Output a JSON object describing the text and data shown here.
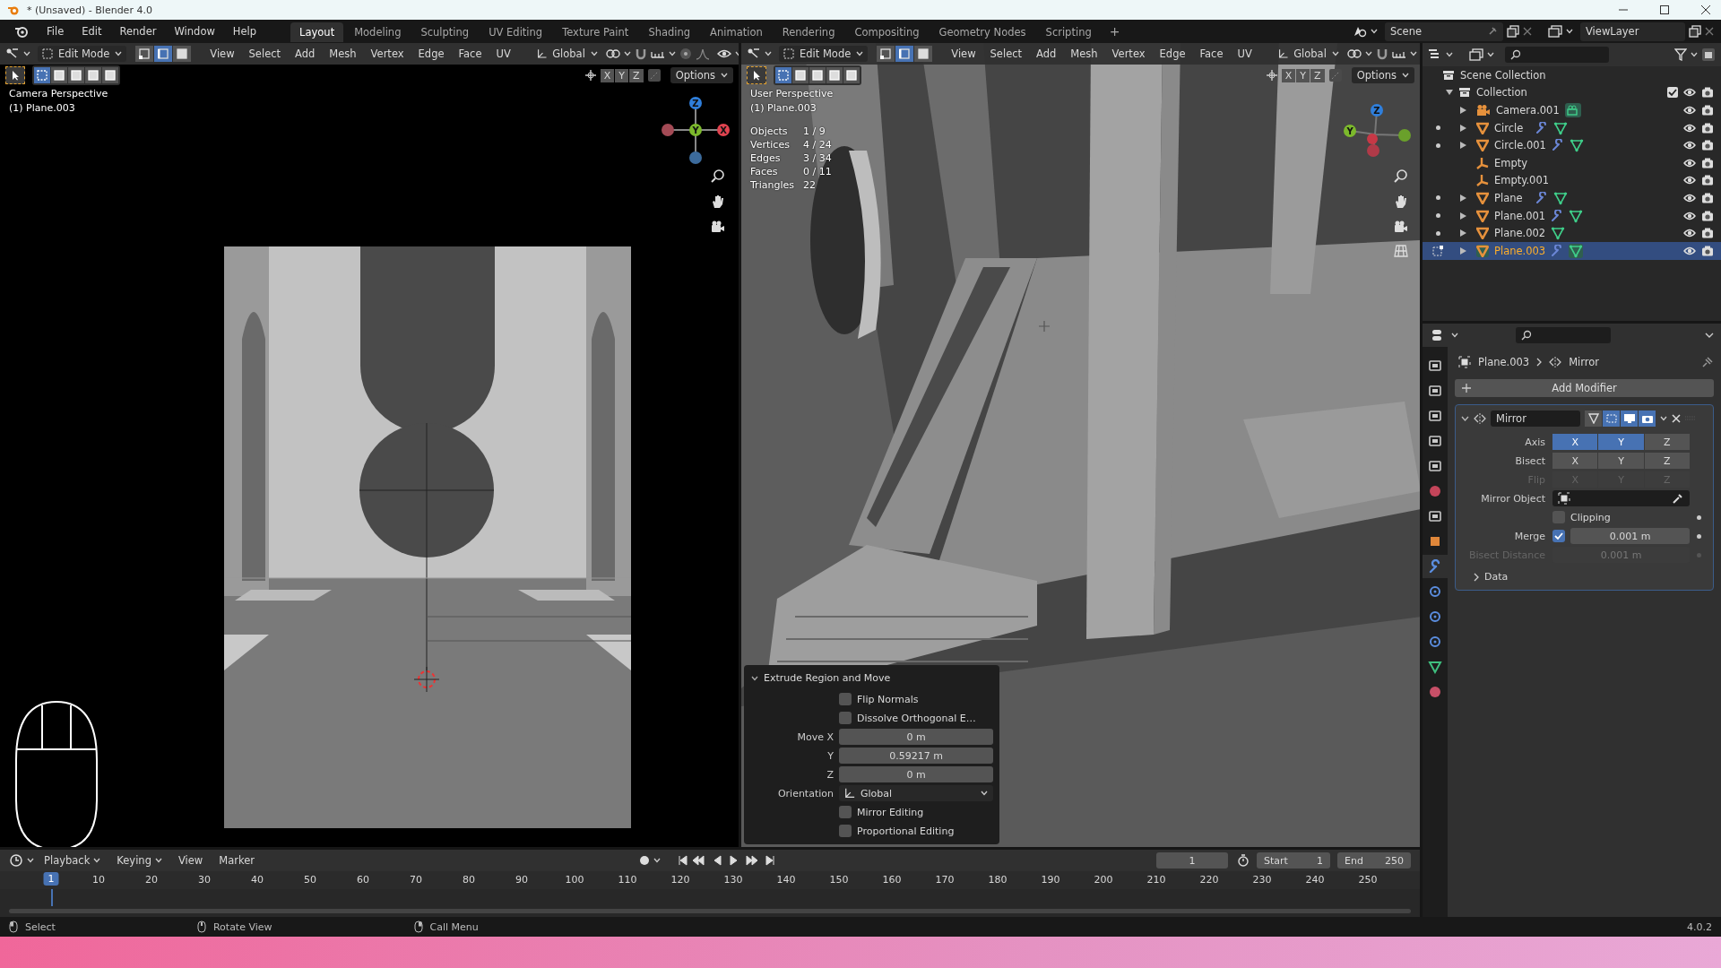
{
  "window": {
    "title": "* (Unsaved) - Blender 4.0"
  },
  "menu_bar": [
    "File",
    "Edit",
    "Render",
    "Window",
    "Help"
  ],
  "workspace_tabs": [
    {
      "label": "Layout",
      "selected": true
    },
    {
      "label": "Modeling",
      "selected": false
    },
    {
      "label": "Sculpting",
      "selected": false
    },
    {
      "label": "UV Editing",
      "selected": false
    },
    {
      "label": "Texture Paint",
      "selected": false
    },
    {
      "label": "Shading",
      "selected": false
    },
    {
      "label": "Animation",
      "selected": false
    },
    {
      "label": "Rendering",
      "selected": false
    },
    {
      "label": "Compositing",
      "selected": false
    },
    {
      "label": "Geometry Nodes",
      "selected": false
    },
    {
      "label": "Scripting",
      "selected": false
    }
  ],
  "add_tab": "+",
  "scene": "Scene",
  "view_layer": "ViewLayer",
  "viewports": [
    {
      "kind": "camera",
      "mode": "Edit Mode",
      "select_modes": [
        {
          "selected": false
        },
        {
          "selected": true
        },
        {
          "selected": false
        }
      ],
      "menus": [
        "View",
        "Select",
        "Add",
        "Mesh",
        "Vertex",
        "Edge",
        "Face",
        "UV"
      ],
      "orientation": "Global",
      "axis_toggles": [
        "X",
        "Y",
        "Z"
      ],
      "options": "Options",
      "view_name": "Camera Perspective",
      "object_label": "(1) Plane.003",
      "gizmo": [
        "Z",
        "Y",
        "X"
      ]
    },
    {
      "kind": "user",
      "mode": "Edit Mode",
      "select_modes": [
        {
          "selected": false
        },
        {
          "selected": true
        },
        {
          "selected": false
        }
      ],
      "menus": [
        "View",
        "Select",
        "Add",
        "Mesh",
        "Vertex",
        "Edge",
        "Face",
        "UV"
      ],
      "orientation": "Global",
      "axis_toggles": [
        "X",
        "Y",
        "Z"
      ],
      "options": "Options",
      "view_name": "User Perspective",
      "object_label": "(1) Plane.003",
      "gizmo": [
        "Z",
        "Y"
      ],
      "stats": [
        {
          "label": "Objects",
          "value": "1 / 9"
        },
        {
          "label": "Vertices",
          "value": "4 / 24"
        },
        {
          "label": "Edges",
          "value": "3 / 34"
        },
        {
          "label": "Faces",
          "value": "0 / 11"
        },
        {
          "label": "Triangles",
          "value": "22"
        }
      ]
    }
  ],
  "operator_panel": {
    "title": "Extrude Region and Move",
    "expanded": true,
    "rows": [
      {
        "kind": "checkbox",
        "label": "Flip Normals",
        "checked": false
      },
      {
        "kind": "checkbox",
        "label": "Dissolve Orthogonal E…",
        "checked": false
      },
      {
        "kind": "value",
        "label": "Move X",
        "value": "0 m"
      },
      {
        "kind": "value",
        "label": "Y",
        "value": "0.59217 m"
      },
      {
        "kind": "value",
        "label": "Z",
        "value": "0 m"
      },
      {
        "kind": "dropdown",
        "label": "Orientation",
        "value": "Global"
      },
      {
        "kind": "checkbox",
        "label": "Mirror Editing",
        "checked": false
      },
      {
        "kind": "checkbox",
        "label": "Proportional Editing",
        "checked": false
      }
    ]
  },
  "outliner": {
    "scene_collection": "Scene Collection",
    "collection": {
      "label": "Collection",
      "expanded": true,
      "checked": true
    },
    "objects": [
      {
        "name": "Camera.001",
        "kind": "camera",
        "has_children": true,
        "modifier": false,
        "data": true,
        "editable": false,
        "edit_mode": false,
        "selected": false
      },
      {
        "name": "Circle",
        "kind": "mesh",
        "has_children": true,
        "modifier": true,
        "data": true,
        "editable": true,
        "edit_mode": false,
        "selected": false
      },
      {
        "name": "Circle.001",
        "kind": "mesh",
        "has_children": true,
        "modifier": true,
        "data": true,
        "editable": true,
        "edit_mode": false,
        "selected": false
      },
      {
        "name": "Empty",
        "kind": "empty",
        "has_children": false,
        "modifier": false,
        "data": false,
        "editable": false,
        "edit_mode": false,
        "selected": false
      },
      {
        "name": "Empty.001",
        "kind": "empty",
        "has_children": false,
        "modifier": false,
        "data": false,
        "editable": false,
        "edit_mode": false,
        "selected": false
      },
      {
        "name": "Plane",
        "kind": "mesh",
        "has_children": true,
        "modifier": true,
        "data": true,
        "editable": true,
        "edit_mode": false,
        "selected": false
      },
      {
        "name": "Plane.001",
        "kind": "mesh",
        "has_children": true,
        "modifier": true,
        "data": true,
        "editable": true,
        "edit_mode": false,
        "selected": false
      },
      {
        "name": "Plane.002",
        "kind": "mesh",
        "has_children": true,
        "modifier": false,
        "data": true,
        "editable": true,
        "edit_mode": false,
        "selected": false
      },
      {
        "name": "Plane.003",
        "kind": "mesh",
        "has_children": true,
        "modifier": true,
        "data": true,
        "editable": true,
        "edit_mode": true,
        "selected": true
      }
    ]
  },
  "properties": {
    "tabs": [
      {
        "kind": "tool",
        "selected": false
      },
      {
        "kind": "render",
        "selected": false
      },
      {
        "kind": "output",
        "selected": false
      },
      {
        "kind": "view_layer",
        "selected": false
      },
      {
        "kind": "scene",
        "selected": false
      },
      {
        "kind": "world",
        "selected": false
      },
      {
        "kind": "collection",
        "selected": false
      },
      {
        "kind": "object",
        "selected": false
      },
      {
        "kind": "modifiers",
        "selected": true
      },
      {
        "kind": "particles",
        "selected": false
      },
      {
        "kind": "physics",
        "selected": false
      },
      {
        "kind": "constraints",
        "selected": false
      },
      {
        "kind": "data",
        "selected": false
      },
      {
        "kind": "material",
        "selected": false
      }
    ],
    "breadcrumb": [
      "Plane.003",
      "Mirror"
    ],
    "add_modifier": "Add Modifier",
    "modifier": {
      "name": "Mirror",
      "expanded": true,
      "toggles": [
        {
          "selected": false
        },
        {
          "selected": true
        },
        {
          "selected": true
        },
        {
          "selected": true
        }
      ],
      "rows": [
        {
          "kind": "toggles",
          "label": "Axis",
          "disabled": false,
          "buttons": [
            {
              "label": "X",
              "selected": true
            },
            {
              "label": "Y",
              "selected": true
            },
            {
              "label": "Z",
              "selected": false
            }
          ]
        },
        {
          "kind": "toggles",
          "label": "Bisect",
          "disabled": false,
          "buttons": [
            {
              "label": "X",
              "selected": false
            },
            {
              "label": "Y",
              "selected": false
            },
            {
              "label": "Z",
              "selected": false
            }
          ]
        },
        {
          "kind": "toggles",
          "label": "Flip",
          "disabled": true,
          "buttons": [
            {
              "label": "X",
              "selected": false
            },
            {
              "label": "Y",
              "selected": false
            },
            {
              "label": "Z",
              "selected": false
            }
          ]
        },
        {
          "kind": "object",
          "label": "Mirror Object"
        },
        {
          "kind": "checkbox",
          "label": "Clipping",
          "checked": false
        },
        {
          "kind": "checkvalue",
          "label": "Merge",
          "checked": true,
          "value": "0.001 m"
        },
        {
          "kind": "value",
          "label": "Bisect Distance",
          "value": "0.001 m",
          "disabled": true
        },
        {
          "kind": "subpanel",
          "label": "Data",
          "expanded": false
        }
      ]
    }
  },
  "timeline": {
    "menus": [
      "Playback",
      "Keying",
      "View",
      "Marker"
    ],
    "current_frame": "1",
    "start_label": "Start",
    "start": "1",
    "end_label": "End",
    "end": "250",
    "playhead": "1",
    "ruler": [
      "10",
      "20",
      "30",
      "40",
      "50",
      "60",
      "70",
      "80",
      "90",
      "100",
      "110",
      "120",
      "130",
      "140",
      "150",
      "160",
      "170",
      "180",
      "190",
      "200",
      "210",
      "220",
      "230",
      "240",
      "250"
    ]
  },
  "status_bar": {
    "items": [
      "Select",
      "Rotate View",
      "Call Menu"
    ],
    "version": "4.0.2"
  }
}
